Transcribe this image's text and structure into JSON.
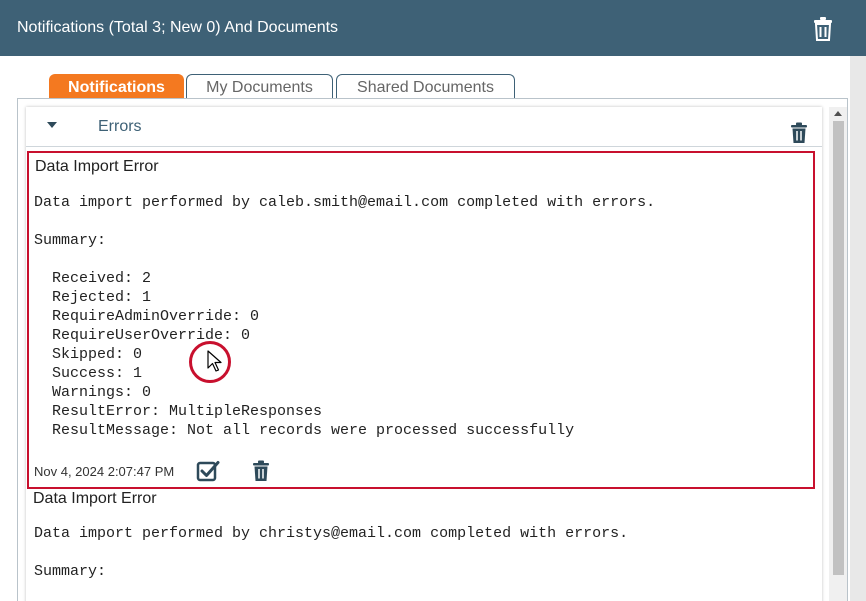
{
  "window": {
    "title": "Notifications (Total 3; New 0) And Documents"
  },
  "tabs": [
    {
      "label": "Notifications",
      "active": true
    },
    {
      "label": "My Documents",
      "active": false
    },
    {
      "label": "Shared Documents",
      "active": false
    }
  ],
  "group": {
    "title": "Errors",
    "expanded": true
  },
  "notifications": [
    {
      "title": "Data Import Error",
      "message": "Data import performed by caleb.smith@email.com completed with errors.",
      "summary_label": "Summary:",
      "summary_lines": [
        "Received: 2",
        "Rejected: 1",
        "RequireAdminOverride: 0",
        "RequireUserOverride: 0",
        "Skipped: 0",
        "Success: 1",
        "Warnings: 0",
        "ResultError: MultipleResponses",
        "ResultMessage: Not all records were processed successfully"
      ],
      "timestamp": "Nov 4, 2024 2:07:47 PM"
    },
    {
      "title": "Data Import Error",
      "message": "Data import performed by christys@email.com completed with errors.",
      "summary_label": "Summary:"
    }
  ],
  "colors": {
    "titlebar": "#3e6176",
    "active_tab": "#f47920",
    "highlight": "#c8102e",
    "icon": "#2e4a5a"
  },
  "icons": {
    "title_delete": "trash-icon",
    "group_delete": "trash-icon",
    "group_toggle": "caret-down-icon",
    "mark_read": "checkbox-checked-icon",
    "notification_delete": "trash-icon",
    "cursor": "mouse-pointer-icon"
  }
}
